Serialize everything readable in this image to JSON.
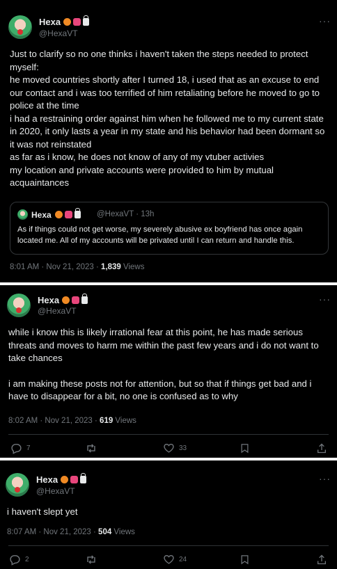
{
  "tweets": [
    {
      "author": {
        "name": "Hexa",
        "handle": "@HexaVT"
      },
      "lines": [
        "Just to clarify so no one thinks i haven't taken the steps needed to protect myself:",
        "he moved countries shortly after I turned 18, i used that as an excuse to end our contact and i was too terrified of him retaliating before he moved to go to police at the time",
        "i had a restraining order against him when he followed me to my current state in 2020, it only lasts a year in my state and his behavior had been dormant so it was not reinstated",
        "as far as i know, he does not know of any of my vtuber activies",
        "my location and private accounts were provided to him by mutual acquaintances"
      ],
      "quote": {
        "name": "Hexa",
        "handle_time": "@HexaVT · 13h",
        "text": "As if things could not get worse, my severely abusive ex boyfriend has once again located me. All of my accounts will be privated until I can return and handle this."
      },
      "meta": {
        "time": "8:01 AM · Nov 21, 2023 · ",
        "views": "1,839",
        "views_label": " Views"
      }
    },
    {
      "author": {
        "name": "Hexa",
        "handle": "@HexaVT"
      },
      "para1": "while i know this is likely irrational fear at this point, he has made serious threats and moves to harm me within the past few years and i do not want to take chances",
      "para2": "i am making these posts not for attention, but so that if things get bad and i have to disappear for a bit, no one is confused as to why",
      "meta": {
        "time": "8:02 AM · Nov 21, 2023 · ",
        "views": "619",
        "views_label": " Views"
      },
      "replies": "7",
      "likes": "33"
    },
    {
      "author": {
        "name": "Hexa",
        "handle": "@HexaVT"
      },
      "text": "i haven't slept yet",
      "meta": {
        "time": "8:07 AM · Nov 21, 2023 · ",
        "views": "504",
        "views_label": " Views"
      },
      "replies": "2",
      "likes": "24"
    }
  ],
  "icons": {
    "more": "more-horizontal-icon",
    "reply": "reply-icon",
    "retweet": "retweet-icon",
    "like": "heart-icon",
    "bookmark": "bookmark-icon",
    "share": "share-icon"
  },
  "colors": {
    "background": "#000000",
    "text": "#e7e9ea",
    "secondary": "#71767b",
    "border": "#2f3336"
  }
}
